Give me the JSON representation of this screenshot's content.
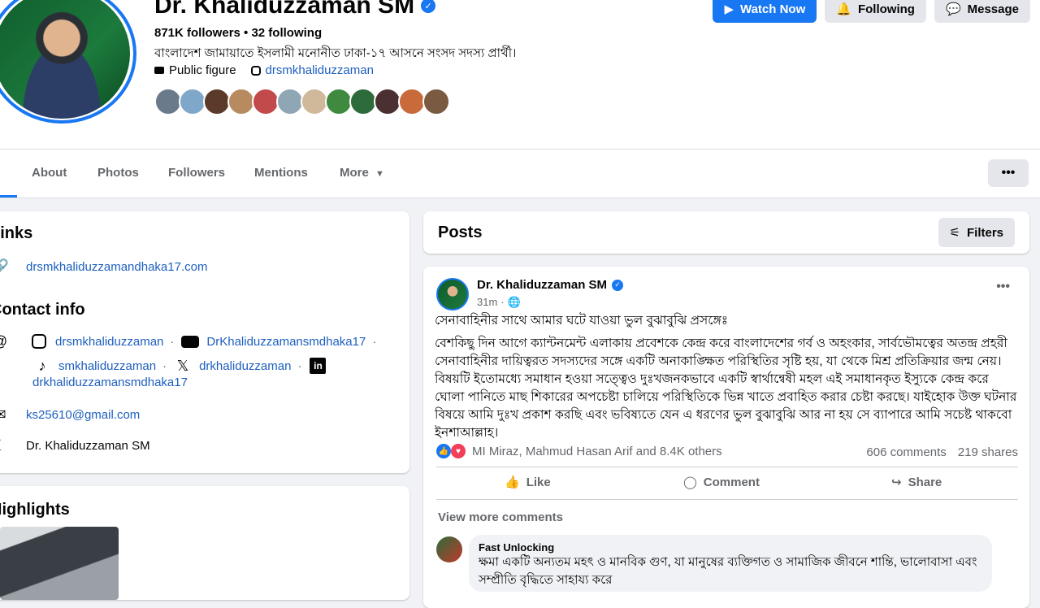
{
  "profile": {
    "name": "Dr. Khaliduzzaman SM",
    "stats": "871K followers • 32 following",
    "bio": "বাংলাদেশ জামায়াতে ইসলামী মনোনীত ঢাকা-১৭ আসনে সংসদ সদস্য প্রার্থী।",
    "category": "Public figure",
    "instagram": "drsmkhaliduzzaman"
  },
  "header_buttons": {
    "watch": "Watch Now",
    "following": "Following",
    "message": "Message"
  },
  "tabs": [
    "About",
    "Photos",
    "Followers",
    "Mentions",
    "More"
  ],
  "intro": {
    "links_title": "Links",
    "website": "drsmkhaliduzzamandhaka17.com",
    "contact_title": "Contact info",
    "instagram": "drsmkhaliduzzaman",
    "youtube": "DrKhaliduzzamansmdhaka17",
    "tiktok": "smkhaliduzzaman",
    "x": "drkhaliduzzaman",
    "linkedin": "drkhaliduzzamansmdhaka17",
    "email": "ks25610@gmail.com",
    "messenger": "Dr. Khaliduzzaman SM",
    "highlights_title": "Highlights"
  },
  "posts": {
    "title": "Posts",
    "filters": "Filters",
    "author": "Dr. Khaliduzzaman SM",
    "time": "31m",
    "heading": "সেনাবাহিনীর সাথে আমার ঘটে যাওয়া ভুল বুঝাবুঝি প্রসঙ্গেঃ",
    "body": "বেশকিছু দিন আগে ক্যান্টনমেন্ট এলাকায় প্রবেশকে কেন্দ্র করে বাংলাদেশের গর্ব ও অহংকার, সার্বভৌমত্বের অতন্দ্র প্রহরী সেনাবাহিনীর দায়িত্বরত সদস্যদের সঙ্গে একটি অনাকাঙ্ক্ষিত পরিস্থিতির সৃষ্টি হয়, যা থেকে মিশ্র প্রতিক্রিয়ার জন্ম নেয়। বিষয়টি ইতোমধ্যে সমাধান হওয়া সত্ত্বেও দুঃখজনকভাবে একটি স্বার্থান্বেষী মহল এই সমাধানকৃত ইস্যুকে কেন্দ্র করে ঘোলা পানিতে মাছ শিকারের অপচেষ্টা চালিয়ে পরিস্থিতিকে ভিন্ন খাতে প্রবাহিত করার চেষ্টা করছে। যাইহোক উক্ত ঘটনার বিষয়ে আমি দুঃখ প্রকাশ করছি এবং ভবিষ্যতে যেন এ ধরণের ভুল বুঝাবুঝি আর না হয় সে ব্যাপারে আমি সচেষ্ট থাকবো ইনশাআল্লাহ।",
    "reactions": "MI Miraz, Mahmud Hasan Arif and 8.4K others",
    "comments": "606 comments",
    "shares": "219 shares",
    "like": "Like",
    "comment": "Comment",
    "share": "Share",
    "view_more": "View more comments",
    "commenter": "Fast Unlocking",
    "comment_text": "ক্ষমা একটি অন্যতম মহৎ ও মানবিক গুণ, যা মানুষের ব্যক্তিগত ও সামাজিক জীবনে শান্তি, ভালোবাসা এবং সম্প্রীতি বৃদ্ধিতে সাহায্য করে"
  },
  "colors": {
    "accent": "#1877f2",
    "link": "#1d5fbf"
  }
}
